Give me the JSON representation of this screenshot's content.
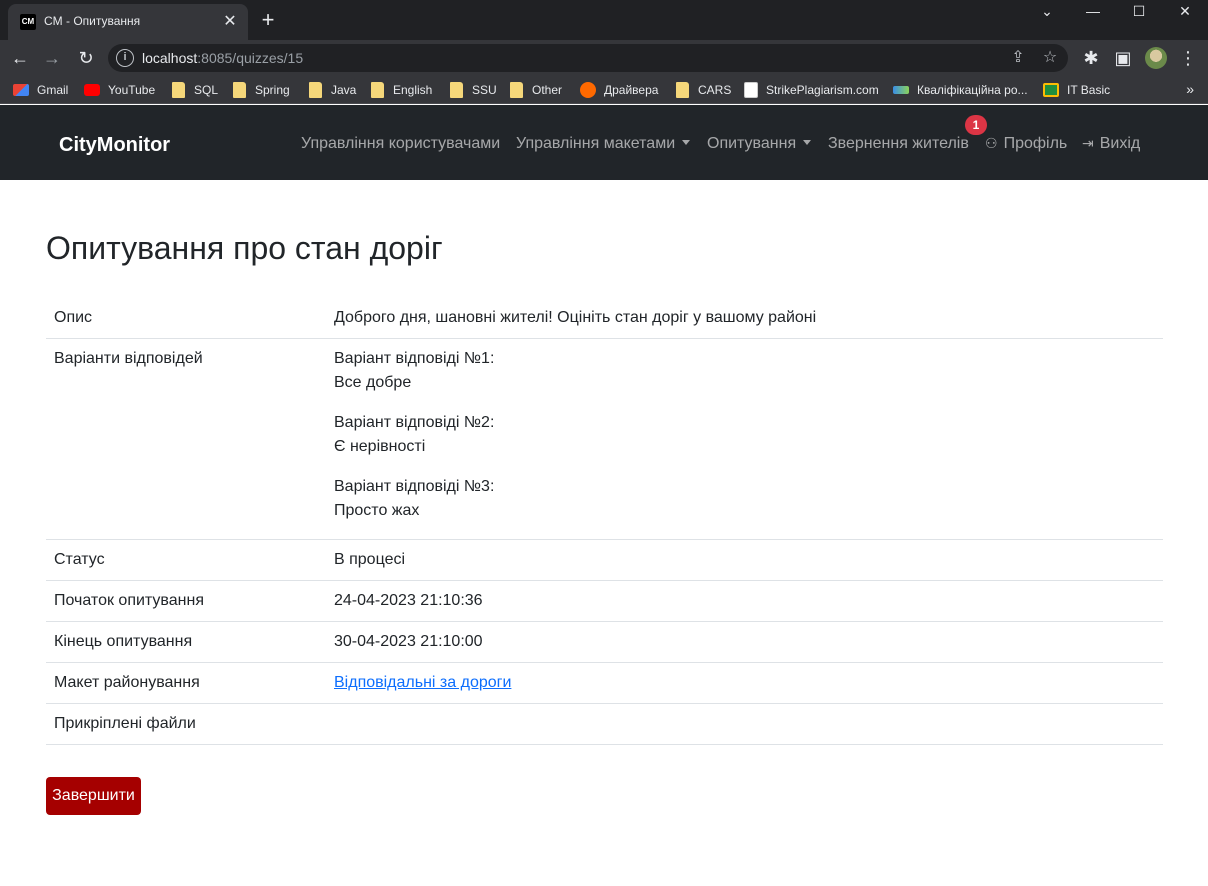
{
  "browser": {
    "tab": {
      "favicon": "CM",
      "title": "CM - Опитування"
    },
    "url": {
      "host": "localhost",
      "rest": ":8085/quizzes/15"
    },
    "bookmarks": [
      {
        "label": "Gmail",
        "icon": "gmail-icon"
      },
      {
        "label": "YouTube",
        "icon": "youtube-icon"
      },
      {
        "label": "SQL",
        "icon": "folder-icon"
      },
      {
        "label": "Spring",
        "icon": "folder-icon"
      },
      {
        "label": "Java",
        "icon": "folder-icon"
      },
      {
        "label": "English",
        "icon": "folder-icon"
      },
      {
        "label": "SSU",
        "icon": "folder-icon"
      },
      {
        "label": "Other",
        "icon": "folder-icon"
      },
      {
        "label": "Драйвера",
        "icon": "mi-icon"
      },
      {
        "label": "CARS",
        "icon": "folder-icon"
      },
      {
        "label": "StrikePlagiarism.com",
        "icon": "page-icon"
      },
      {
        "label": "Кваліфікаційна ро...",
        "icon": "site-icon"
      },
      {
        "label": "IT Basic",
        "icon": "classroom-icon"
      }
    ]
  },
  "navbar": {
    "brand": "CityMonitor",
    "items": {
      "users": "Управління користувачами",
      "layouts": "Управління макетами",
      "quizzes": "Опитування",
      "appeals": "Звернення жителів",
      "profile": "Профіль",
      "logout": "Вихід"
    },
    "badge": "1"
  },
  "quiz": {
    "title": "Опитування про стан доріг",
    "rows": {
      "description_label": "Опис",
      "description_value": "Доброго дня, шановні жителі! Оцініть стан доріг у вашому районі",
      "options_label": "Варіанти відповідей",
      "options": [
        {
          "header": "Варіант відповіді №1:",
          "text": "Все добре"
        },
        {
          "header": "Варіант відповіді №2:",
          "text": "Є нерівності"
        },
        {
          "header": "Варіант відповіді №3:",
          "text": "Просто жах"
        }
      ],
      "status_label": "Статус",
      "status_value": "В процесі",
      "start_label": "Початок опитування",
      "start_value": "24-04-2023 21:10:36",
      "end_label": "Кінець опитування",
      "end_value": "30-04-2023 21:10:00",
      "layout_label": "Макет районування",
      "layout_value": "Відповідальні за дороги",
      "files_label": "Прикріплені файли"
    },
    "finish_button": "Завершити"
  },
  "colors": {
    "navbar_bg": "#212529",
    "badge": "#dc3545",
    "link": "#0d6efd",
    "finish_button": "#a50000"
  }
}
